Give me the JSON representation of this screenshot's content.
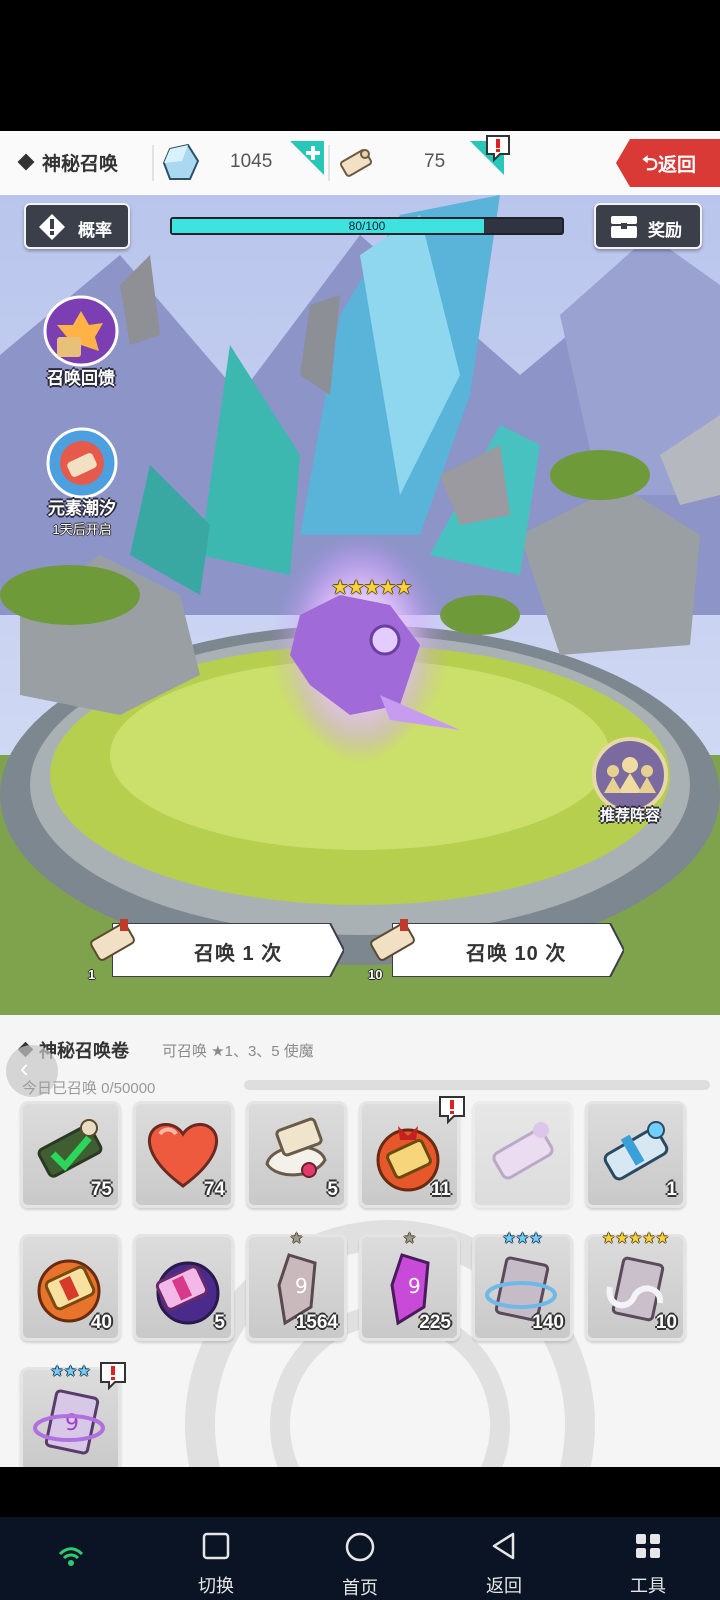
{
  "header": {
    "title": "神秘召唤",
    "gems": "1045",
    "scrolls": "75",
    "back_label": "返回"
  },
  "scene": {
    "rate_label": "概率",
    "reward_label": "奖励",
    "progress_text": "80/100",
    "progress_fraction": 0.8,
    "feedback_label": "召唤回馈",
    "elemental_label": "元素潮汐",
    "elemental_sub": "1天后开启",
    "lineup_label": "推荐阵容",
    "summon_1_label": "召唤 1 次",
    "summon_1_cost": "1",
    "summon_10_label": "召唤 10 次",
    "summon_10_cost": "10"
  },
  "panel": {
    "title": "神秘召唤卷",
    "desc": "可召唤 ★1、3、5 使魔",
    "today": "今日已召唤 0/50000",
    "items": [
      {
        "icon": "check-scroll-icon",
        "count": "75"
      },
      {
        "icon": "heart-icon",
        "count": "74"
      },
      {
        "icon": "pearl-scroll-icon",
        "count": "5"
      },
      {
        "icon": "red-ribbon-scroll-icon",
        "count": "11"
      },
      {
        "icon": "purple-scroll-icon",
        "count": ""
      },
      {
        "icon": "blue-scroll-icon",
        "count": "1"
      },
      {
        "icon": "orange-scroll-icon",
        "count": "40"
      },
      {
        "icon": "violet-scroll-icon",
        "count": "5"
      },
      {
        "icon": "shard-1star-icon",
        "count": "1564"
      },
      {
        "icon": "purple-shard-1star-icon",
        "count": "225"
      },
      {
        "icon": "card-3star-icon",
        "count": "140"
      },
      {
        "icon": "card-5star-icon",
        "count": "10"
      },
      {
        "icon": "card-3star-purple-icon",
        "count": ""
      }
    ]
  },
  "nav": {
    "switch": "切换",
    "home": "首页",
    "back": "返回",
    "tools": "工具"
  },
  "colors": {
    "accent_cyan": "#3ee3e0",
    "back_red": "#d93a36",
    "nav_bg": "#0a1424"
  }
}
